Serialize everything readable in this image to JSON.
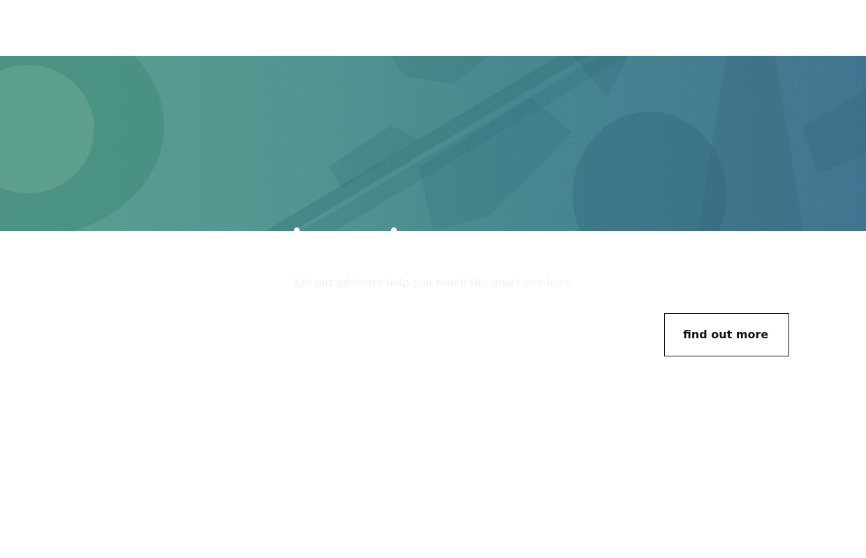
{
  "hero": {
    "background_colors": [
      "#5a9e8e",
      "#4f9590",
      "#46868f",
      "#3f738f"
    ],
    "image": "banknote-texture"
  },
  "main": {
    "subtitle": "Let our advisors help you reach the goals you have",
    "cta_label": "find out more"
  }
}
